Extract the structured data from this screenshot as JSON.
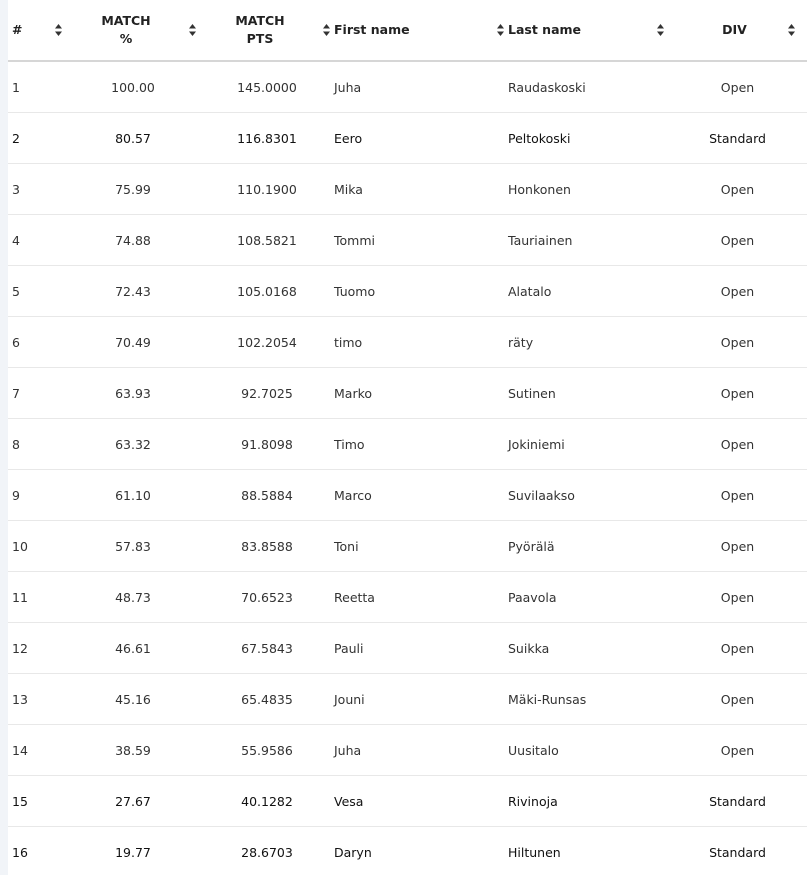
{
  "table": {
    "columns": [
      {
        "label": "#"
      },
      {
        "label_line1": "MATCH",
        "label_line2": "%"
      },
      {
        "label_line1": "MATCH",
        "label_line2": "PTS"
      },
      {
        "label": "First name"
      },
      {
        "label": "Last name"
      },
      {
        "label": "DIV"
      }
    ],
    "rows": [
      {
        "rank": "1",
        "match_pct": "100.00",
        "match_pts": "145.0000",
        "first": "Juha",
        "last": "Raudaskoski",
        "div": "Open"
      },
      {
        "rank": "2",
        "match_pct": "80.57",
        "match_pts": "116.8301",
        "first": "Eero",
        "last": "Peltokoski",
        "div": "Standard"
      },
      {
        "rank": "3",
        "match_pct": "75.99",
        "match_pts": "110.1900",
        "first": "Mika",
        "last": "Honkonen",
        "div": "Open"
      },
      {
        "rank": "4",
        "match_pct": "74.88",
        "match_pts": "108.5821",
        "first": "Tommi",
        "last": "Tauriainen",
        "div": "Open"
      },
      {
        "rank": "5",
        "match_pct": "72.43",
        "match_pts": "105.0168",
        "first": "Tuomo",
        "last": "Alatalo",
        "div": "Open"
      },
      {
        "rank": "6",
        "match_pct": "70.49",
        "match_pts": "102.2054",
        "first": "timo",
        "last": "räty",
        "div": "Open"
      },
      {
        "rank": "7",
        "match_pct": "63.93",
        "match_pts": "92.7025",
        "first": "Marko",
        "last": "Sutinen",
        "div": "Open"
      },
      {
        "rank": "8",
        "match_pct": "63.32",
        "match_pts": "91.8098",
        "first": "Timo",
        "last": "Jokiniemi",
        "div": "Open"
      },
      {
        "rank": "9",
        "match_pct": "61.10",
        "match_pts": "88.5884",
        "first": "Marco",
        "last": "Suvilaakso",
        "div": "Open"
      },
      {
        "rank": "10",
        "match_pct": "57.83",
        "match_pts": "83.8588",
        "first": "Toni",
        "last": "Pyörälä",
        "div": "Open"
      },
      {
        "rank": "11",
        "match_pct": "48.73",
        "match_pts": "70.6523",
        "first": "Reetta",
        "last": "Paavola",
        "div": "Open"
      },
      {
        "rank": "12",
        "match_pct": "46.61",
        "match_pts": "67.5843",
        "first": "Pauli",
        "last": "Suikka",
        "div": "Open"
      },
      {
        "rank": "13",
        "match_pct": "45.16",
        "match_pts": "65.4835",
        "first": "Jouni",
        "last": "Mäki-Runsas",
        "div": "Open"
      },
      {
        "rank": "14",
        "match_pct": "38.59",
        "match_pts": "55.9586",
        "first": "Juha",
        "last": "Uusitalo",
        "div": "Open"
      },
      {
        "rank": "15",
        "match_pct": "27.67",
        "match_pts": "40.1282",
        "first": "Vesa",
        "last": "Rivinoja",
        "div": "Standard"
      },
      {
        "rank": "16",
        "match_pct": "19.77",
        "match_pts": "28.6703",
        "first": "Daryn",
        "last": "Hiltunen",
        "div": "Standard"
      }
    ]
  },
  "icons": {
    "sort": "sort-up-down-icon"
  }
}
